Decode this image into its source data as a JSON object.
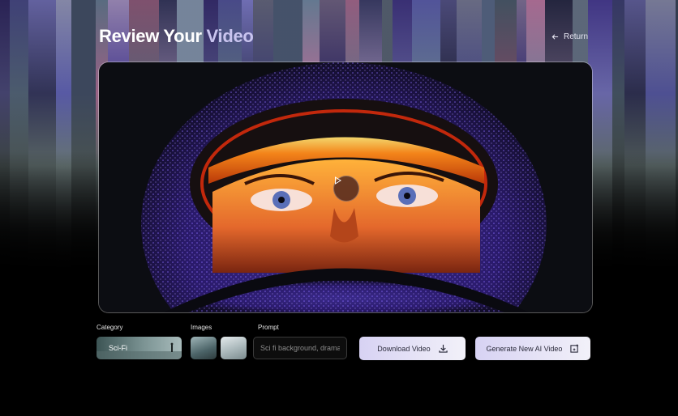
{
  "header": {
    "title_part1": "Review Your",
    "title_part2": "Video",
    "return_label": "Return"
  },
  "controls": {
    "category": {
      "label": "Category",
      "value": "Sci-Fi"
    },
    "images": {
      "label": "Images"
    },
    "prompt": {
      "label": "Prompt",
      "value": "Sci fi background, drama"
    },
    "download_label": "Download Video",
    "generate_label": "Generate New AI Video"
  },
  "icons": [
    "arrow-left-icon",
    "play-icon",
    "download-icon",
    "add-video-icon"
  ],
  "colors": {
    "accent": "#c9c4ef",
    "button_start": "#d7d2f3",
    "button_end": "#f2f1f9",
    "visor_orange": "#ff7a1a"
  }
}
